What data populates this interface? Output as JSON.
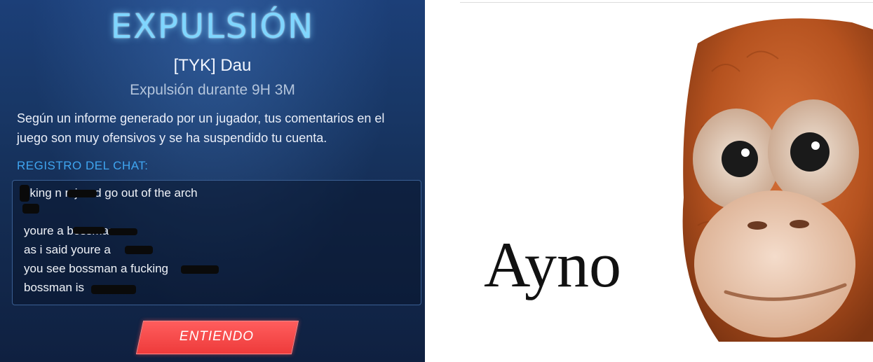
{
  "dialog": {
    "title": "EXPULSIÓN",
    "player": "[TYK] Dau",
    "duration": "Expulsión durante 9H 3M",
    "reason": "Según un informe generado por un jugador, tus comentarios en el juego son muy ofensivos y se ha suspendido tu cuenta.",
    "chat_label": "REGISTRO DEL CHAT:",
    "chat_lines": [
      "cking n     n jared go out of the arch",
      "",
      "youre a           bossman",
      "as i said youre a",
      "you see bossman a fucking",
      "bossman is"
    ],
    "ok_button": "ENTIENDO"
  },
  "meme": {
    "caption": "Ayno",
    "image": "orangutan-plush"
  },
  "colors": {
    "title_glow": "#7fd6ff",
    "chat_label": "#3fa5f0",
    "button_red": "#ee3b3b"
  }
}
